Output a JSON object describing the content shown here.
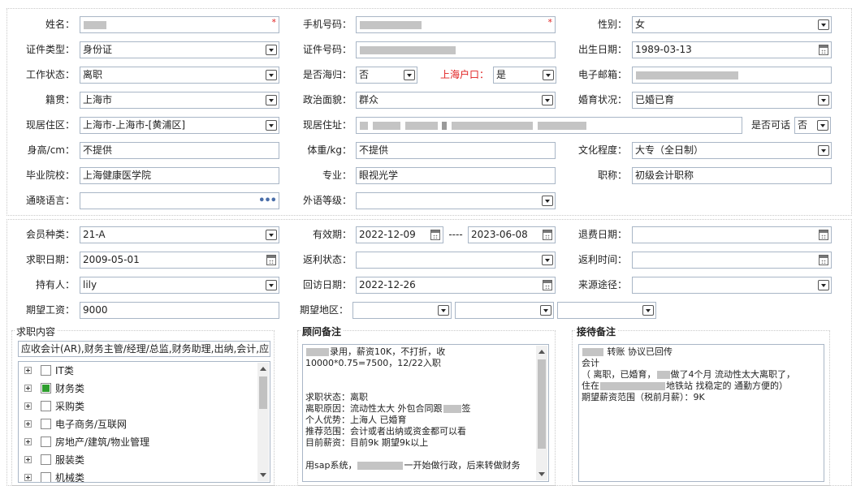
{
  "personal": {
    "name": {
      "label": "姓名：",
      "value": ""
    },
    "phone": {
      "label": "手机号码：",
      "value": ""
    },
    "gender": {
      "label": "性别：",
      "value": "女"
    },
    "id_type": {
      "label": "证件类型：",
      "value": "身份证"
    },
    "id_number": {
      "label": "证件号码：",
      "value": ""
    },
    "birth_date": {
      "label": "出生日期：",
      "value": "1989-03-13"
    },
    "work_status": {
      "label": "工作状态：",
      "value": "离职"
    },
    "returnee": {
      "label": "是否海归：",
      "value": "否"
    },
    "shanghai_hukou": {
      "label": "上海户口：",
      "value": "是"
    },
    "email": {
      "label": "电子邮箱：",
      "value": ""
    },
    "native_place": {
      "label": "籍贯：",
      "value": "上海市"
    },
    "political_status": {
      "label": "政治面貌：",
      "value": "群众"
    },
    "marital_status": {
      "label": "婚育状况：",
      "value": "已婚已育"
    },
    "residence_area": {
      "label": "现居住区：",
      "value": "上海市-上海市-[黄浦区]"
    },
    "residence_address": {
      "label": "现居住址：",
      "value": ""
    },
    "reachable": {
      "label": "是否可话",
      "value": "否"
    },
    "height": {
      "label": "身高/cm：",
      "value": "不提供"
    },
    "weight": {
      "label": "体重/kg：",
      "value": "不提供"
    },
    "education": {
      "label": "文化程度：",
      "value": "大专（全日制）"
    },
    "school": {
      "label": "毕业院校：",
      "value": "上海健康医学院"
    },
    "major": {
      "label": "专业：",
      "value": "眼视光学"
    },
    "title": {
      "label": "职称：",
      "value": "初级会计职称"
    },
    "languages": {
      "label": "通晓语言：",
      "value": ""
    },
    "foreign_level": {
      "label": "外语等级：",
      "value": ""
    }
  },
  "membership": {
    "member_type": {
      "label": "会员种类：",
      "value": "21-A"
    },
    "validity": {
      "label": "有效期：",
      "from": "2022-12-09",
      "sep": "----",
      "to": "2023-06-08"
    },
    "refund_date": {
      "label": "退费日期：",
      "value": ""
    },
    "job_seek_date": {
      "label": "求职日期：",
      "value": "2009-05-01"
    },
    "rebate_status": {
      "label": "返利状态：",
      "value": ""
    },
    "rebate_time": {
      "label": "返利时间：",
      "value": ""
    },
    "holder": {
      "label": "持有人：",
      "value": "lily"
    },
    "visit_date": {
      "label": "回访日期：",
      "value": "2022-12-26"
    },
    "source": {
      "label": "来源途径：",
      "value": ""
    },
    "expected_salary": {
      "label": "期望工资：",
      "value": "9000"
    },
    "expected_area": {
      "label": "期望地区：",
      "value": ""
    }
  },
  "job_content": {
    "title": "求职内容",
    "summary": "应收会计(AR),财务主管/经理/总监,财务助理,出纳,会计,应",
    "tree": [
      {
        "label": "IT类",
        "checked": false
      },
      {
        "label": "财务类",
        "checked": true
      },
      {
        "label": "采购类",
        "checked": false
      },
      {
        "label": "电子商务/互联网",
        "checked": false
      },
      {
        "label": "房地产/建筑/物业管理",
        "checked": false
      },
      {
        "label": "服装类",
        "checked": false
      },
      {
        "label": "机械类",
        "checked": false
      }
    ]
  },
  "advisor_note": {
    "title": "顾问备注",
    "lines": [
      "录用，薪资10K，不打折，收",
      "10000*0.75=7500，12/22入职",
      "",
      "",
      "求职状态：离职",
      "离职原因：流动性太大  外包合同跟",
      "个人优势：上海人  已婚育",
      "推荐范围：会计或者出纳或资金都可以看",
      "目前薪资：目前9k  期望9k以上",
      "",
      "用sap系统，一开始做行政，后来转做财务"
    ],
    "line_suffix": {
      "0": "",
      "5": "签",
      "10": ""
    }
  },
  "reception_note": {
    "title": "接待备注",
    "lines": [
      "转账  协议已回传",
      "会计",
      "（ 离职，已婚育，做了4个月  流动性太大离职了，",
      "住在地铁站 找稳定的 通勤方便的）",
      "期望薪资范围（税前月薪）：9K"
    ]
  },
  "colors": {
    "border": "#a9b6c6",
    "required": "#e02020",
    "checked": "#2e9e2e"
  }
}
